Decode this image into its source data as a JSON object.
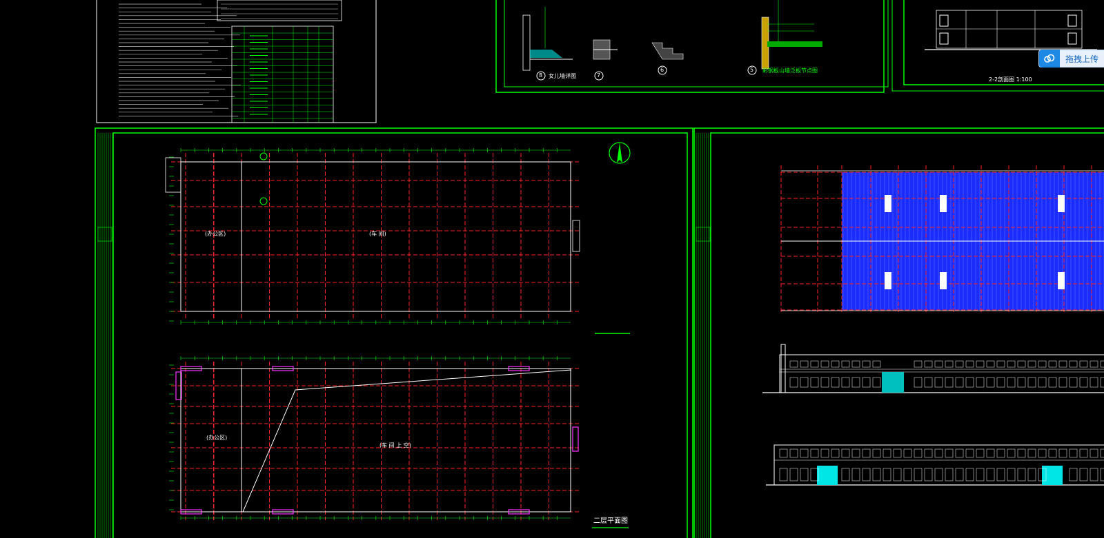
{
  "floor1": {
    "office_label": "(办公区)",
    "workshop_label": "(车 间)"
  },
  "floor2": {
    "office_label": "(办公区)",
    "workshop_label": "(车 间 上 空)",
    "title": "二层平面图"
  },
  "details": {
    "d8": "8",
    "d8_label": "女儿墙详图",
    "d7": "7",
    "d6": "6",
    "d5": "5",
    "d5_label": "彩钢板山墙泛板节点图"
  },
  "section": {
    "title": "2-2剖面图 1:100"
  },
  "toolbar": {
    "upload_label": "拖拽上传"
  },
  "colors": {
    "frame": "#00ff00",
    "grid_axis": "#ff2222",
    "wall": "#ffffff",
    "roof_panel": "#1a2cff",
    "door": "#00e5e5",
    "magenta": "#ff33ff",
    "background": "#000000"
  }
}
